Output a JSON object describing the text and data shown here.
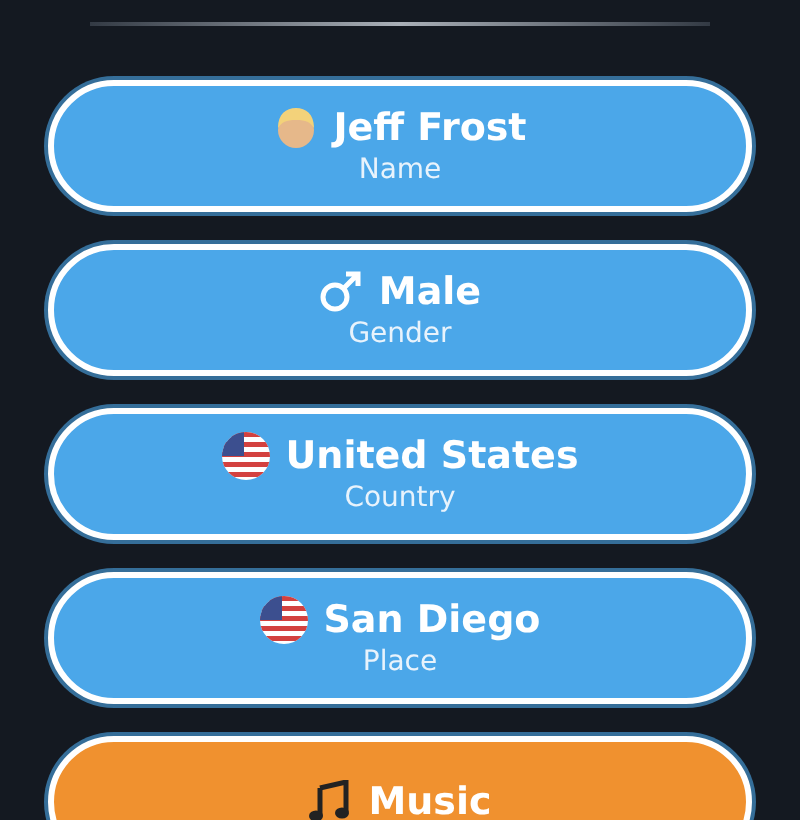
{
  "buttons": [
    {
      "kind": "avatar",
      "title": "Jeff Frost",
      "subtitle": "Name",
      "color": "#4ba7e9"
    },
    {
      "kind": "gender",
      "title": "Male",
      "subtitle": "Gender",
      "color": "#4ba7e9"
    },
    {
      "kind": "flag",
      "title": "United States",
      "subtitle": "Country",
      "color": "#4ba7e9"
    },
    {
      "kind": "flag",
      "title": "San Diego",
      "subtitle": "Place",
      "color": "#4ba7e9"
    },
    {
      "kind": "music",
      "title": "Music",
      "color": "#f0912f"
    }
  ]
}
